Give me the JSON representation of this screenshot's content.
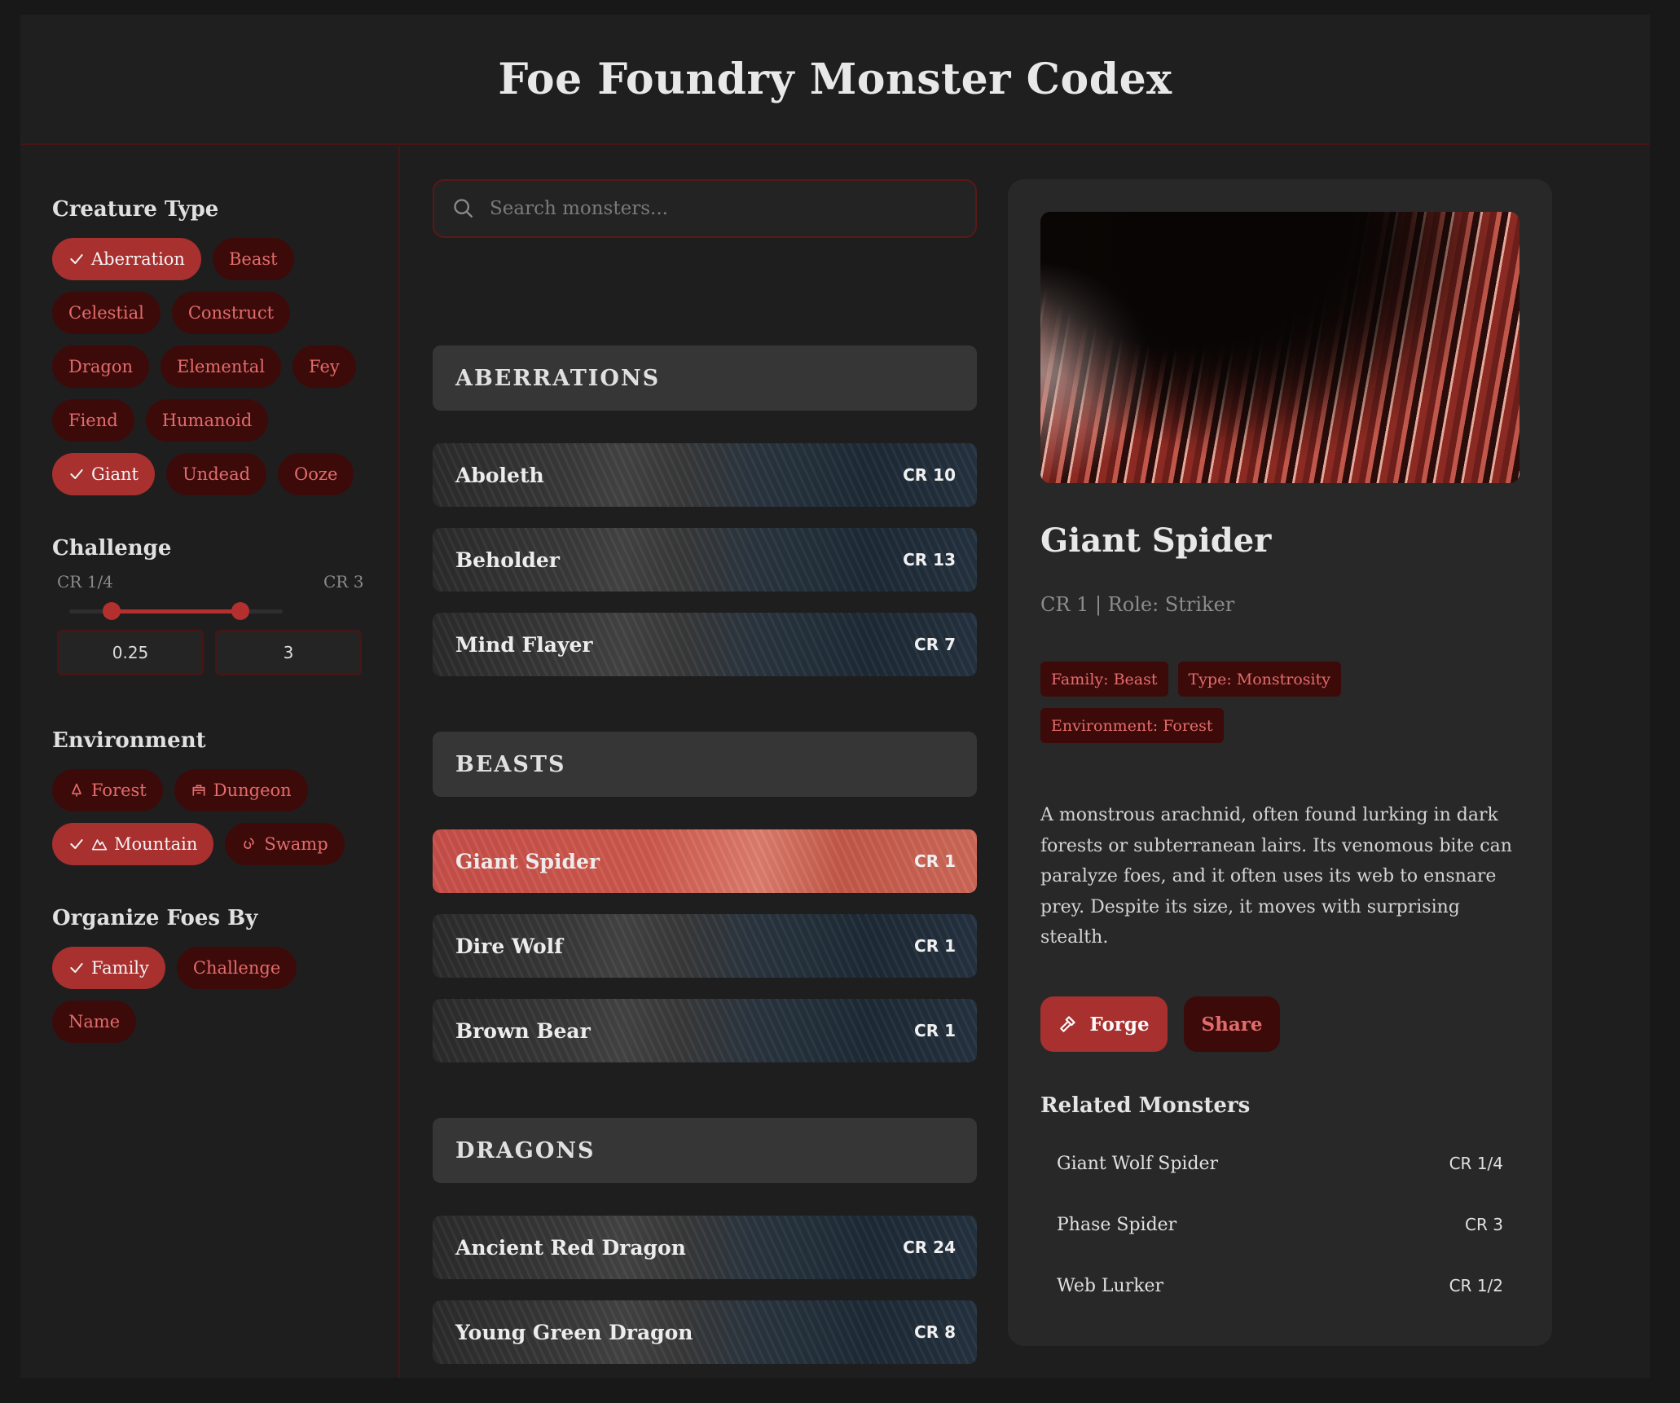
{
  "app": {
    "title": "Foe Foundry Monster Codex"
  },
  "sidebar": {
    "creature_type": {
      "title": "Creature Type",
      "chips": [
        {
          "label": "Aberration",
          "active": true
        },
        {
          "label": "Beast",
          "active": false
        },
        {
          "label": "Celestial",
          "active": false
        },
        {
          "label": "Construct",
          "active": false
        },
        {
          "label": "Dragon",
          "active": false
        },
        {
          "label": "Elemental",
          "active": false
        },
        {
          "label": "Fey",
          "active": false
        },
        {
          "label": "Fiend",
          "active": false
        },
        {
          "label": "Humanoid",
          "active": false
        },
        {
          "label": "Giant",
          "active": true
        },
        {
          "label": "Undead",
          "active": false
        },
        {
          "label": "Ooze",
          "active": false
        }
      ]
    },
    "challenge": {
      "title": "Challenge",
      "min_label": "CR 1/4",
      "max_label": "CR 3",
      "min_value": "0.25",
      "max_value": "3",
      "range_fraction": [
        0.2,
        0.8
      ]
    },
    "environment": {
      "title": "Environment",
      "chips": [
        {
          "label": "Forest",
          "icon": "tree-icon",
          "active": false
        },
        {
          "label": "Dungeon",
          "icon": "dungeon-icon",
          "active": false
        },
        {
          "label": "Mountain",
          "icon": "mountain-icon",
          "active": true
        },
        {
          "label": "Swamp",
          "icon": "swamp-icon",
          "active": false
        }
      ]
    },
    "organize": {
      "title": "Organize Foes By",
      "chips": [
        {
          "label": "Family",
          "active": true
        },
        {
          "label": "Challenge",
          "active": false
        },
        {
          "label": "Name",
          "active": false
        }
      ]
    }
  },
  "search": {
    "placeholder": "Search monsters..."
  },
  "groups": [
    {
      "header": "ABERRATIONS",
      "rows": [
        {
          "name": "Aboleth",
          "cr": "CR 10"
        },
        {
          "name": "Beholder",
          "cr": "CR 13"
        },
        {
          "name": "Mind Flayer",
          "cr": "CR 7"
        }
      ]
    },
    {
      "header": "BEASTS",
      "rows": [
        {
          "name": "Giant Spider",
          "cr": "CR 1",
          "selected": true
        },
        {
          "name": "Dire Wolf",
          "cr": "CR 1"
        },
        {
          "name": "Brown Bear",
          "cr": "CR 1"
        }
      ]
    },
    {
      "header": "DRAGONS",
      "rows": [
        {
          "name": "Ancient Red Dragon",
          "cr": "CR 24"
        },
        {
          "name": "Young Green Dragon",
          "cr": "CR 8"
        }
      ]
    }
  ],
  "detail": {
    "name": "Giant Spider",
    "subtitle": "CR 1 | Role: Striker",
    "tags": [
      "Family: Beast",
      "Type: Monstrosity",
      "Environment: Forest"
    ],
    "description": "A monstrous arachnid, often found lurking in dark forests or subterranean lairs. Its venomous bite can paralyze foes, and it often uses its web to ensnare prey. Despite its size, it moves with surprising stealth.",
    "forge_label": "Forge",
    "share_label": "Share",
    "related_title": "Related Monsters",
    "related": [
      {
        "name": "Giant Wolf Spider",
        "cr": "CR 1/4"
      },
      {
        "name": "Phase Spider",
        "cr": "CR 3"
      },
      {
        "name": "Web Lurker",
        "cr": "CR 1/2"
      }
    ]
  },
  "colors": {
    "accent": "#a8302f",
    "chip_bg": "#3d0a0a",
    "chip_text": "#e26c6c",
    "border": "#4a1414"
  }
}
